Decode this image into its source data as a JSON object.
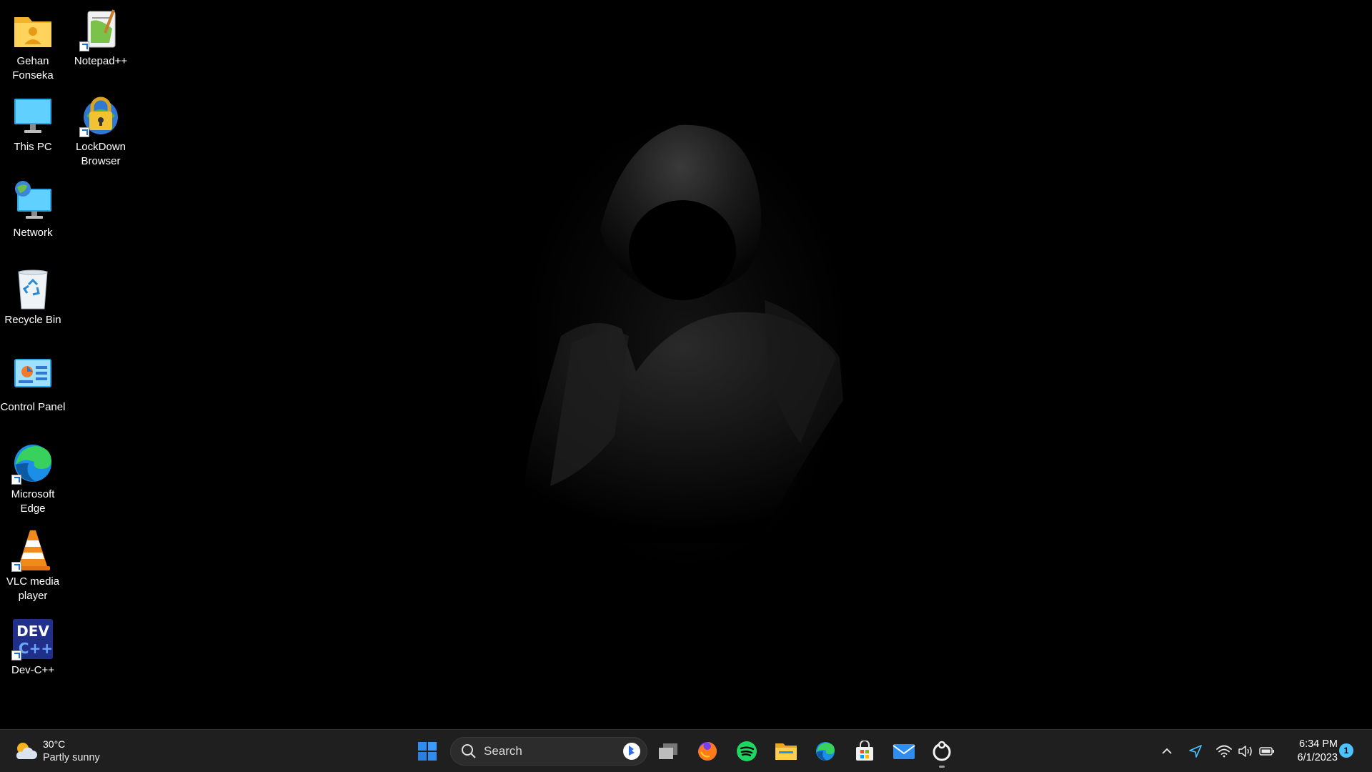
{
  "desktop": {
    "icons": [
      {
        "label": "Gehan\nFonseka",
        "icon": "user-folder-icon"
      },
      {
        "label": "Notepad++",
        "icon": "notepad-plus-plus-icon"
      },
      {
        "label": "This PC",
        "icon": "monitor-icon"
      },
      {
        "label": "LockDown\nBrowser",
        "icon": "lockdown-browser-icon"
      },
      {
        "label": "Network",
        "icon": "network-globe-icon"
      },
      {
        "label": "Recycle Bin",
        "icon": "recycle-bin-icon"
      },
      {
        "label": "Control Panel",
        "icon": "control-panel-icon"
      },
      {
        "label": "Microsoft\nEdge",
        "icon": "edge-icon"
      },
      {
        "label": "VLC media\nplayer",
        "icon": "vlc-cone-icon"
      },
      {
        "label": "Dev-C++",
        "icon": "dev-cpp-icon"
      }
    ]
  },
  "taskbar": {
    "weather": {
      "temp": "30°C",
      "desc": "Partly sunny",
      "icon": "partly-sunny-icon"
    },
    "search": {
      "placeholder": "Search"
    },
    "apps": [
      "start-icon",
      "task-view-icon",
      "firefox-icon",
      "spotify-icon",
      "file-explorer-icon",
      "edge-icon",
      "microsoft-store-icon",
      "mail-icon",
      "obs-icon"
    ],
    "tray": {
      "time": "6:34 PM",
      "date": "6/1/2023",
      "notification_count": "1"
    }
  },
  "colors": {
    "taskbar_bg": "#1f1f1f",
    "accent": "#4cc2ff",
    "start_blue": "#2f8cf0"
  }
}
